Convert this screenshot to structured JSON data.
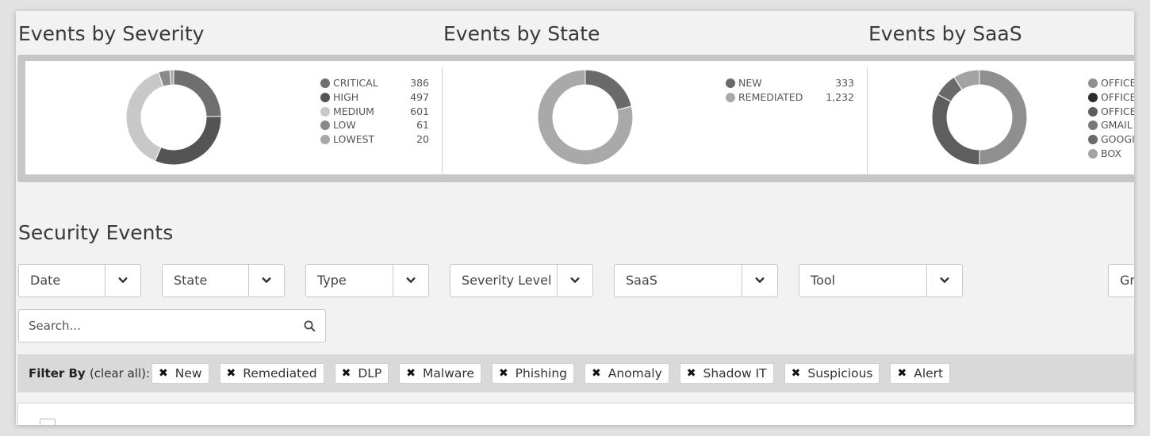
{
  "charts": {
    "severity": {
      "title": "Events by Severity",
      "items": [
        {
          "label": "CRITICAL",
          "value": "386",
          "color": "#6f6f6f"
        },
        {
          "label": "HIGH",
          "value": "497",
          "color": "#545454"
        },
        {
          "label": "MEDIUM",
          "value": "601",
          "color": "#c8c8c8"
        },
        {
          "label": "LOW",
          "value": "61",
          "color": "#8a8a8a"
        },
        {
          "label": "LOWEST",
          "value": "20",
          "color": "#a8a8a8"
        }
      ]
    },
    "state": {
      "title": "Events by State",
      "items": [
        {
          "label": "NEW",
          "value": "333",
          "color": "#6a6a6a"
        },
        {
          "label": "REMEDIATED",
          "value": "1,232",
          "color": "#a9a9a9"
        }
      ]
    },
    "saas": {
      "title": "Events by SaaS",
      "items": [
        {
          "label": "OFFICE",
          "value": "",
          "color": "#8f8f8f"
        },
        {
          "label": "OFFICE",
          "value": "",
          "color": "#2b2b2b"
        },
        {
          "label": "OFFICE",
          "value": "",
          "color": "#5e5e5e"
        },
        {
          "label": "GMAIL",
          "value": "",
          "color": "#777777"
        },
        {
          "label": "GOOGI",
          "value": "",
          "color": "#6a6a6a"
        },
        {
          "label": "BOX",
          "value": "",
          "color": "#a3a3a3"
        }
      ]
    }
  },
  "chart_data": [
    {
      "type": "pie",
      "title": "Events by Severity",
      "labels": [
        "CRITICAL",
        "HIGH",
        "MEDIUM",
        "LOW",
        "LOWEST"
      ],
      "values": [
        386,
        497,
        601,
        61,
        20
      ]
    },
    {
      "type": "pie",
      "title": "Events by State",
      "labels": [
        "NEW",
        "REMEDIATED"
      ],
      "values": [
        333,
        1232
      ]
    },
    {
      "type": "pie",
      "title": "Events by SaaS",
      "labels": [
        "OFFICE",
        "OFFICE",
        "OFFICE",
        "GMAIL",
        "GOOGI",
        "BOX"
      ],
      "values": [
        50,
        0,
        33,
        0,
        8,
        9
      ]
    }
  ],
  "section_title": "Security Events",
  "filters": [
    {
      "label": "Date"
    },
    {
      "label": "State"
    },
    {
      "label": "Type"
    },
    {
      "label": "Severity Level"
    },
    {
      "label": "SaaS"
    },
    {
      "label": "Tool"
    },
    {
      "label": "Gr"
    }
  ],
  "search": {
    "placeholder": "Search..."
  },
  "filter_by": {
    "label": "Filter By",
    "clear": "(clear all):",
    "chips": [
      "New",
      "Remediated",
      "DLP",
      "Malware",
      "Phishing",
      "Anomaly",
      "Shadow IT",
      "Suspicious",
      "Alert"
    ],
    "remove_symbol": "✖"
  }
}
